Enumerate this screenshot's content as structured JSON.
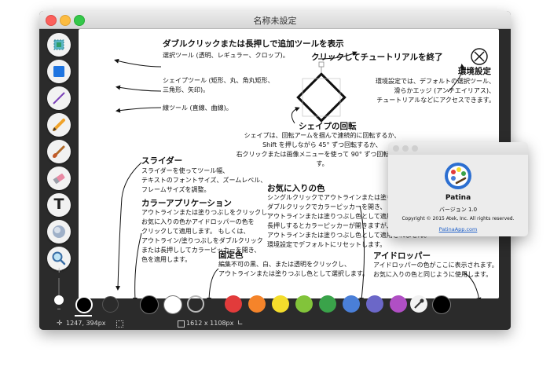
{
  "window": {
    "title": "名称未設定"
  },
  "tools": [
    {
      "name": "select-tool-button",
      "icon": "select-icon"
    },
    {
      "name": "shape-tool-button",
      "icon": "square-shape-icon"
    },
    {
      "name": "line-tool-button",
      "icon": "line-icon"
    },
    {
      "name": "pencil-tool-button",
      "icon": "pencil-icon"
    },
    {
      "name": "brush-tool-button",
      "icon": "brush-icon"
    },
    {
      "name": "eraser-tool-button",
      "icon": "eraser-icon"
    },
    {
      "name": "text-tool-button",
      "icon": "text-icon"
    },
    {
      "name": "blur-tool-button",
      "icon": "blur-icon"
    },
    {
      "name": "zoom-tool-button",
      "icon": "magnifier-icon"
    }
  ],
  "tool_text_label": "T",
  "slider": {
    "plus": "+",
    "minus": "–"
  },
  "tutorial": {
    "tools_heading": "ダブルクリックまたは長押しで追加ツールを表示",
    "select_tool": "選択ツール (透明、レギュラー、クロップ)。",
    "shape_tool": "シェイプツール (矩形、丸、角丸矩形、\n三角形、矢印)。",
    "line_tool": "線ツール (直線、曲線)。",
    "close_heading": "クリックしてチュートリアルを終了",
    "settings_heading": "環境設定",
    "settings_body": "環境設定では、デフォルトの選択ツール、\n滑らかエッジ (アンチエイリアス)、\nチュートリアルなどにアクセスできます。",
    "rotate_heading": "シェイプの回転",
    "rotate_body": "シェイプは、回転アームを掴んで連続的に回転するか、\nShift を押しながら 45° ずつ回転するか、\n右クリックまたは画像メニューを使って 90° ずつ回転できます。",
    "slider_heading": "スライダー",
    "slider_body": "スライダーを使ってツール幅、\nテキストのフォントサイズ、ズームレベル、\nフレームサイズを調整。",
    "color_app_heading": "カラーアプリケーション",
    "color_app_body": "アウトラインまたは塗りつぶしをクリックし、\nお気に入りの色かアイドロッパーの色を\nクリックして適用します。 もしくは、\nアウトライン/塗りつぶしをダブルクリック\nまたは長押ししてカラーピッカーを開き、\n色を適用します。",
    "favorites_heading": "お気に入りの色",
    "favorites_body": "シングルクリックでアウトラインまたは塗りつぶし色として\nダブルクリックでカラーピッカーを開き、\nアウトラインまたは塗りつぶし色として適用します。\n長押しするとカラーピッカーが開きますが、\nアウトラインまたは塗りつぶし色として適用されません。\n環境設定でデフォルトにリセットします。",
    "fixed_heading": "固定色",
    "fixed_body": "編集不可の黒、白、または透明をクリックし、\nアウトラインまたは塗りつぶし色として選択します。",
    "eyedropper_heading": "アイドロッパー",
    "eyedropper_body": "アイドロッパーの色がここに表示されます。\nお気に入りの色と同じように使用します。"
  },
  "fixed_colors": [
    "#000000",
    "#ffffff",
    "transparent"
  ],
  "favorite_colors": [
    "#e23b3b",
    "#f5842a",
    "#f4dd2c",
    "#82c43a",
    "#3aa34a",
    "#4a7fd8",
    "#6b67c8",
    "#b04fc4"
  ],
  "eyedropper_color": "#000000",
  "status": {
    "cursor": "1247, 394px",
    "size": "1612 x 1108px"
  },
  "about": {
    "app_name": "Patina",
    "version": "バージョン 1.0",
    "copyright": "Copyright © 2015 Atek, Inc. All rights reserved.",
    "link": "PatinaApp.com"
  }
}
